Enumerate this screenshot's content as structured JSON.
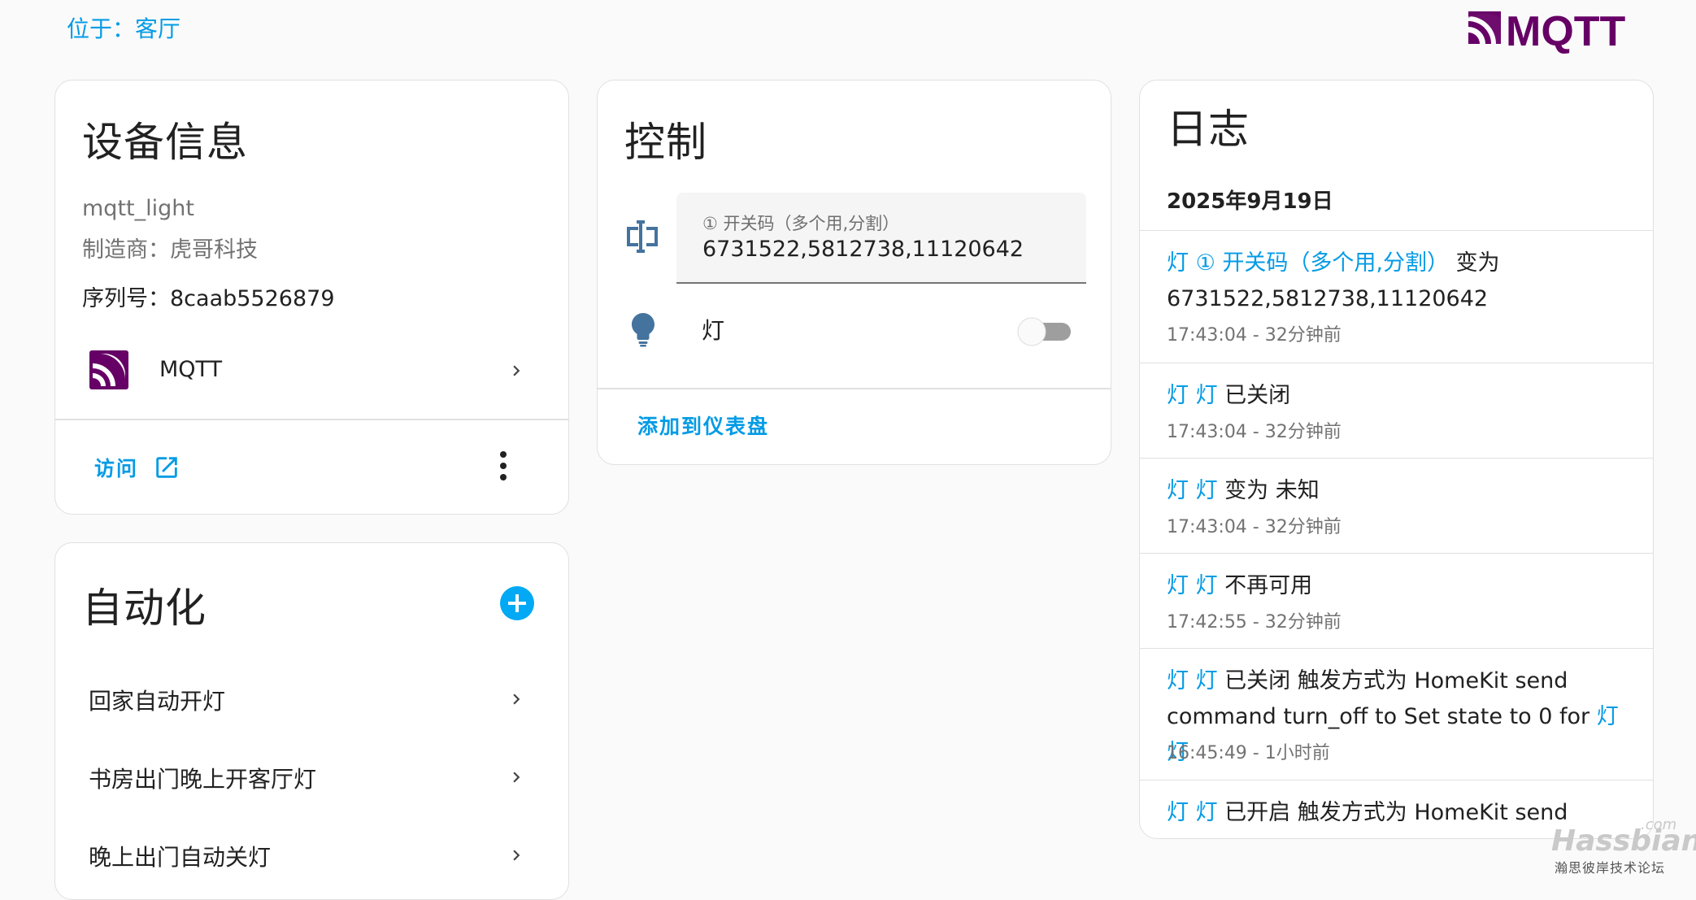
{
  "header": {
    "area_link": "位于：客厅",
    "logo_text": "MQTT"
  },
  "device_info": {
    "title": "设备信息",
    "model": "mqtt_light",
    "manufacturer": "制造商：虎哥科技",
    "serial": "序列号：8caab5526879",
    "integration_label": "MQTT",
    "visit_label": "访问"
  },
  "automation": {
    "title": "自动化",
    "items": [
      {
        "label": "回家自动开灯"
      },
      {
        "label": "书房出门晚上开客厅灯"
      },
      {
        "label": "晚上出门自动关灯"
      }
    ]
  },
  "control": {
    "title": "控制",
    "text_field": {
      "label": "① 开关码（多个用,分割）",
      "value": "6731522,5812738,11120642"
    },
    "light_label": "灯",
    "light_on": false,
    "add_to_dashboard": "添加到仪表盘"
  },
  "logbook": {
    "title": "日志",
    "date": "2025年9月19日",
    "entries": [
      {
        "entity": "灯 ① 开关码（多个用,分割）",
        "message": " 变为 6731522,5812738,11120642",
        "time": "17:43:04 - 32分钟前"
      },
      {
        "entity": "灯 灯",
        "message": " 已关闭",
        "time": "17:43:04 - 32分钟前"
      },
      {
        "entity": "灯 灯",
        "message": " 变为 未知",
        "time": "17:43:04 - 32分钟前"
      },
      {
        "entity": "灯 灯",
        "message": " 不再可用",
        "time": "17:42:55 - 32分钟前"
      },
      {
        "entity": "灯 灯",
        "message": " 已关闭 触发方式为 HomeKit send command turn_off to Set state to 0 for ",
        "entity2": "灯 灯",
        "time": "16:45:49 - 1小时前"
      },
      {
        "entity": "灯 灯",
        "message": " 已开启 触发方式为 HomeKit send",
        "time": ""
      }
    ]
  },
  "watermark": {
    "brand": "Hassbian",
    "domain": ".com",
    "subtitle": "瀚思彼岸技术论坛"
  },
  "colors": {
    "accent": "#039be5",
    "mqtt_purple": "#660066",
    "icon_blue": "#44739e"
  }
}
